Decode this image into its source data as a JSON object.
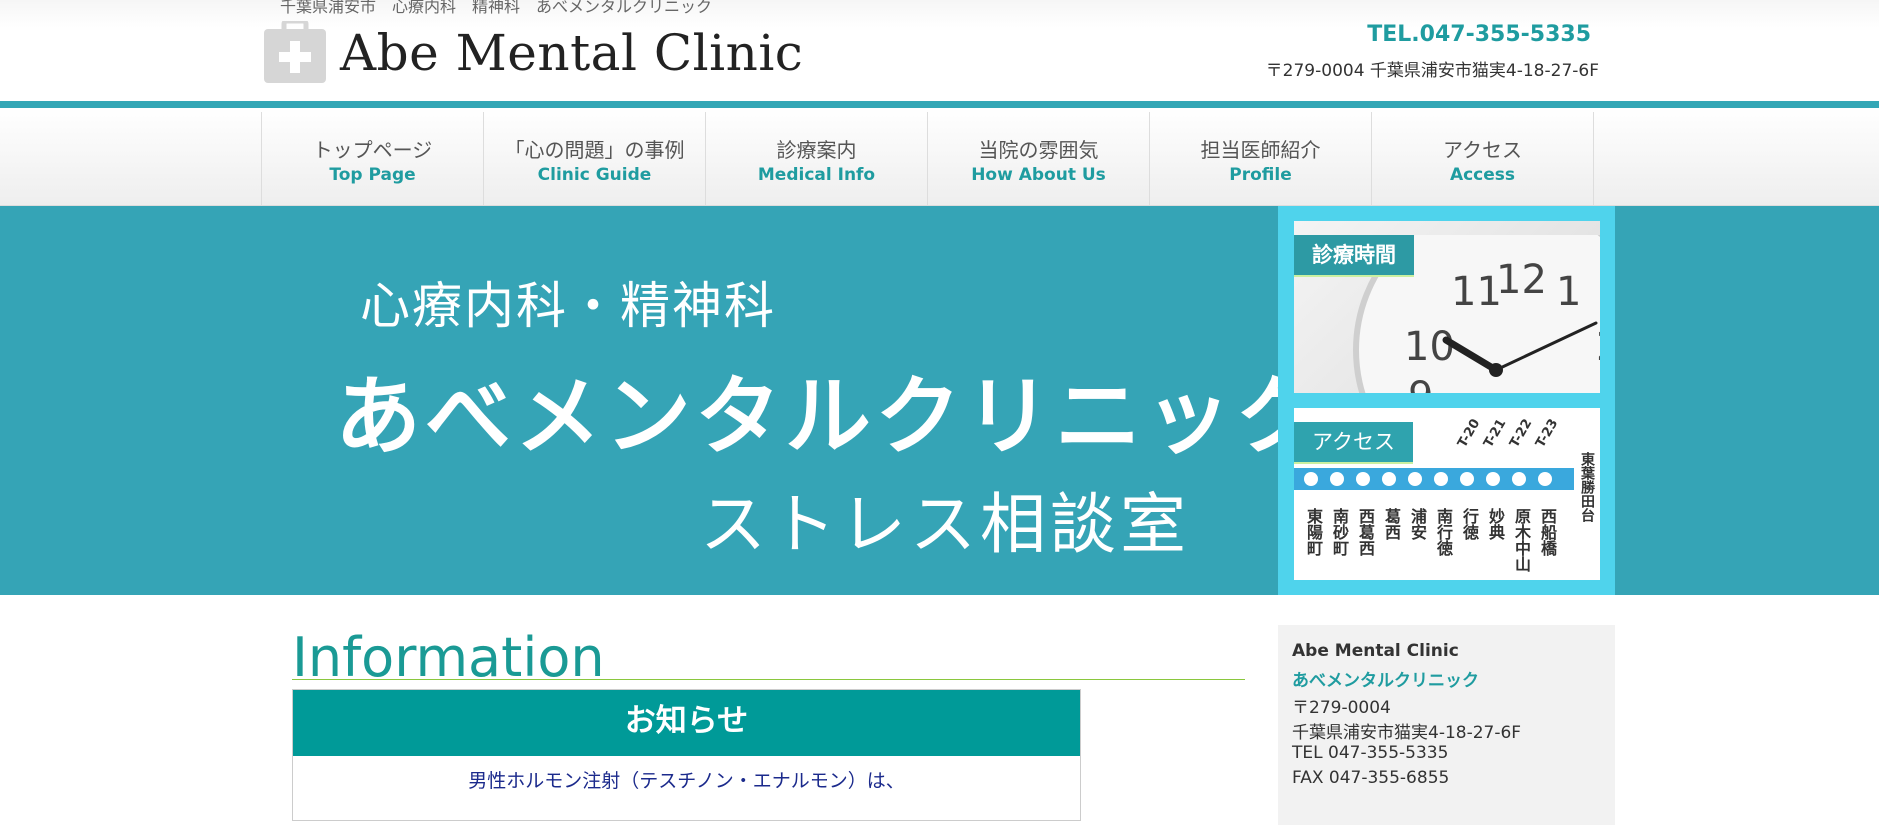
{
  "header": {
    "tagline": "千葉県浦安市　心療内科　精神科　あべメンタルクリニック",
    "logo_text": "Abe Mental Clinic",
    "tel": "TEL.047-355-5335",
    "address": "〒279-0004 千葉県浦安市猫実4-18-27-6F"
  },
  "nav": {
    "items": [
      {
        "jp": "トップページ",
        "en": "Top Page"
      },
      {
        "jp": "「心の問題」の事例",
        "en": "Clinic Guide"
      },
      {
        "jp": "診療案内",
        "en": "Medical Info"
      },
      {
        "jp": "当院の雰囲気",
        "en": "How About Us"
      },
      {
        "jp": "担当医師紹介",
        "en": "Profile"
      },
      {
        "jp": "アクセス",
        "en": "Access"
      }
    ]
  },
  "hero": {
    "subtitle": "心療内科・精神科",
    "title": "あべメンタルクリニック",
    "sub2": "ストレス相談室"
  },
  "side": {
    "hours_label": "診療時間",
    "access_label": "アクセス",
    "stations": [
      "東陽町",
      "南砂町",
      "西葛西",
      "葛西",
      "浦安",
      "南行徳",
      "行徳",
      "妙典",
      "原木中山",
      "西船橋",
      "東葉勝田台"
    ],
    "station_codes": [
      "T-20",
      "T-21",
      "T-22",
      "T-23"
    ]
  },
  "info": {
    "title": "Information",
    "notice_head": "お知らせ",
    "notice_body": "男性ホルモン注射（テスチノン・エナルモン）は、"
  },
  "sidebar": {
    "name_en": "Abe Mental Clinic",
    "name_jp": "あべメンタルクリニック",
    "zip": "〒279-0004",
    "address": "千葉県浦安市猫実4-18-27-6F",
    "tel": "TEL 047-355-5335",
    "fax": "FAX 047-355-6855"
  },
  "colors": {
    "accent": "#1f9ca0",
    "hero_bg": "#35a4b6",
    "side_panel": "#4fd3ec",
    "notice_head": "#009a98"
  }
}
